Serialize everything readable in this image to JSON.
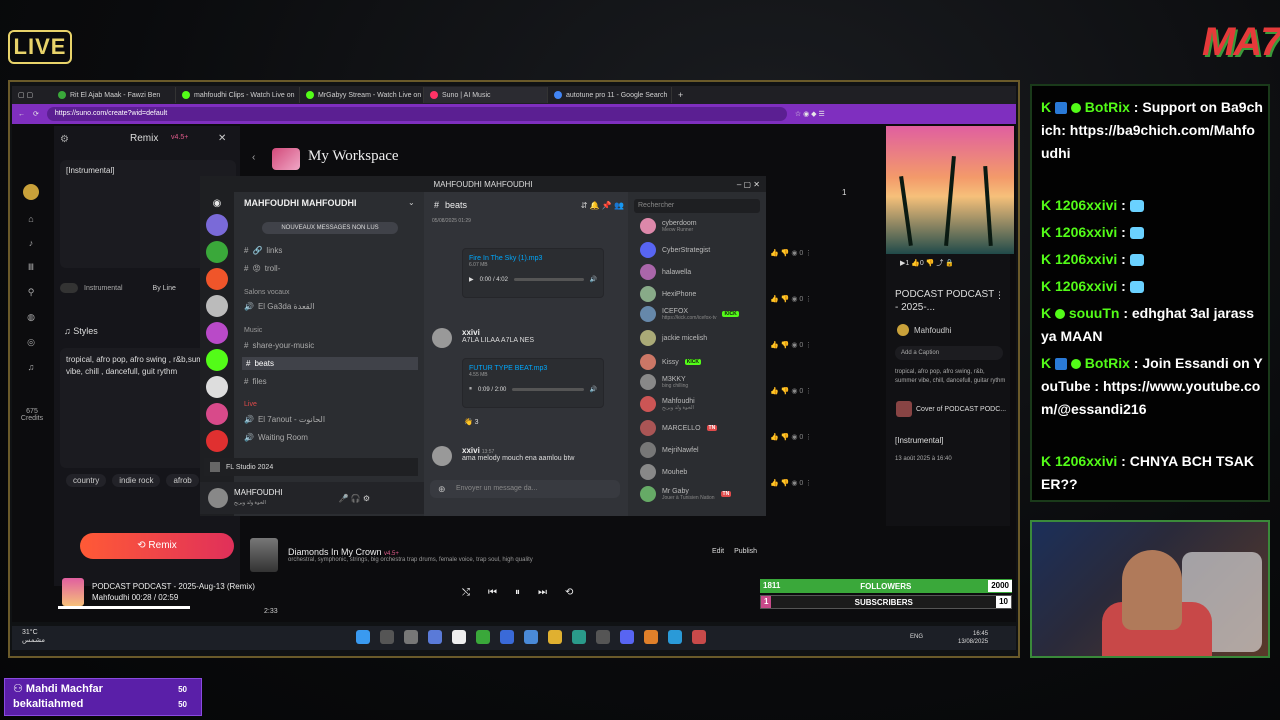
{
  "overlay": {
    "live_label": "LIVE",
    "logo": "MA7",
    "followers": {
      "current": "1811",
      "label": "FOLLOWERS",
      "goal": "2000",
      "fraction": 0.905
    },
    "subscribers": {
      "current": "1",
      "label": "SUBSCRIBERS",
      "goal": "10",
      "fraction": 0.1
    },
    "sub_popup": [
      {
        "name": "Mahdi Machfar",
        "count": "50"
      },
      {
        "name": "bekaltiahmed",
        "count": "50"
      }
    ]
  },
  "browser": {
    "tabs": [
      {
        "label": "Rit El Ajab Maak - Fawzi Ben",
        "color": "#3aa83a"
      },
      {
        "label": "mahfoudhi Clips - Watch Live on",
        "color": "#53fc18"
      },
      {
        "label": "MrGabyy Stream - Watch Live on",
        "color": "#53fc18"
      },
      {
        "label": "Suno | AI Music",
        "color": "#f36"
      },
      {
        "label": "autotune pro 11 - Google Search",
        "color": "#4285f4"
      }
    ],
    "url": "https://suno.com/create?wid=default"
  },
  "suno": {
    "remix_title": "Remix",
    "version": "v4.5+",
    "lyrics": "[Instrumental]",
    "instrumental_label": "Instrumental",
    "by_line_label": "By Line",
    "styles_title": "Styles",
    "styles_text": "tropical, afro pop, afro swing , r&b,summer vibe, chill , dancefull, guit rythm",
    "chips": [
      "country",
      "indie rock",
      "afrob"
    ],
    "credits_value": "675",
    "credits_label": "Credits",
    "remix_button": "Remix",
    "workspace_title": "My Workspace",
    "page_number": "1",
    "right_card": {
      "title": "PODCAST PODCAST - 2025-...",
      "author": "Mahfoudhi",
      "caption_placeholder": "Add a Caption",
      "tags": "tropical, afro pop, afro swing, r&b, summer vibe, chill, dancefull, guitar rythm",
      "cover_of": "Cover of PODCAST PODC...",
      "lyrics": "[Instrumental]",
      "date": "13 août 2025 à 16:40"
    },
    "bottom_song": {
      "title": "Diamonds In My Crown",
      "badge": "v4.5+",
      "desc": "orchestral, symphonic, strings, big orchestra trap drums, female voice, trap soul, high quality",
      "duration": "2:33",
      "edit": "Edit",
      "publish": "Publish"
    },
    "player": {
      "title": "PODCAST PODCAST - 2025-Aug-13 (Remix)",
      "author": "Mahfoudhi",
      "time": "00:28 / 02:59",
      "progress_fraction": 0.16
    }
  },
  "discord": {
    "window_title": "MAHFOUDHI MAHFOUDHI",
    "server_name": "MAHFOUDHI MAHFOUDHI",
    "unread_banner": "NOUVEAUX MESSAGES NON LUS",
    "channels": [
      {
        "label": "links",
        "prefix": "🔗"
      },
      {
        "label": "troll-",
        "prefix": "😡"
      }
    ],
    "voice_category": "Salons vocaux",
    "voice_channels": [
      "El Ga3da القعدة"
    ],
    "music_category": "Music",
    "music_channels": [
      "share-your-music",
      "beats",
      "files"
    ],
    "live_category": "Live",
    "live_channels": [
      "El 7anout - الحانوت",
      "Waiting Room"
    ],
    "fl_studio": "FL Studio 2024",
    "user_name": "MAHFOUDHI",
    "user_status": "الخوة ولد ويربح",
    "active_channel": "beats",
    "search_placeholder": "Rechercher",
    "msg_date": "05/08/2025 01:29",
    "attach1": {
      "name": "Fire In The Sky (1).mp3",
      "size": "6.07 MB",
      "time": "0:00 / 4:02"
    },
    "msg2_author": "xxivi",
    "msg2_text": "A7LA LILAA A7LA NES",
    "attach2": {
      "name": "FUTUR TYPE BEAT.mp3",
      "size": "4.55 MB",
      "time": "0:09 / 2:00"
    },
    "reaction_count": "3",
    "msg3_author": "xxivi",
    "msg3_time": "13:57",
    "msg3_text": "ama melody mouch ena aamlou btw",
    "input_placeholder": "Envoyer un message da...",
    "members": [
      {
        "name": "cyberdoom",
        "sub": "Meow Runner",
        "color": "#d8a"
      },
      {
        "name": "CyberStrategist",
        "sub": "",
        "color": "#5865f2"
      },
      {
        "name": "halawella",
        "sub": "",
        "color": "#a6a"
      },
      {
        "name": "HexiPhone",
        "sub": "",
        "color": "#8a8"
      },
      {
        "name": "ICEFOX",
        "sub": "https://kick.com/icefox-tv",
        "color": "#68a",
        "kick": true
      },
      {
        "name": "jackie micelish",
        "sub": "",
        "color": "#aa7"
      },
      {
        "name": "Kissy",
        "sub": "",
        "color": "#c76",
        "kick": true
      },
      {
        "name": "M3KKY",
        "sub": "bing chilling",
        "color": "#888"
      },
      {
        "name": "Mahfoudhi",
        "sub": "الخوة ولد ويربح",
        "color": "#c55"
      },
      {
        "name": "MARCELLO",
        "sub": "",
        "color": "#a55",
        "badge": "TN"
      },
      {
        "name": "MejriNawfel",
        "sub": "",
        "color": "#777"
      },
      {
        "name": "Mouheb",
        "sub": "",
        "color": "#888"
      },
      {
        "name": "Mr Gaby",
        "sub": "Jouer à Tunisien Nation",
        "color": "#6a6",
        "badge": "TN"
      }
    ]
  },
  "taskbar": {
    "weather_temp": "31°C",
    "weather_desc": "مشمس",
    "lang": "ENG",
    "time": "16:45",
    "date": "13/08/2025"
  },
  "chat": [
    {
      "user": "BotRix",
      "bot": true,
      "text": "Support on Ba9chich: https://ba9chich.com/Mahfoudhi"
    },
    {
      "user": "1206xxivi",
      "bot": false,
      "text": ""
    },
    {
      "user": "1206xxivi",
      "bot": false,
      "text": ""
    },
    {
      "user": "1206xxivi",
      "bot": false,
      "text": ""
    },
    {
      "user": "1206xxivi",
      "bot": false,
      "text": ""
    },
    {
      "user": "souuTn",
      "bot": false,
      "text": "edhghat 3al jarass ya MAAN"
    },
    {
      "user": "BotRix",
      "bot": true,
      "text": "Join Essandi on YouTube : https://www.youtube.com/@essandi216"
    },
    {
      "user": "1206xxivi",
      "bot": false,
      "text": "CHNYA BCH TSAKER??"
    }
  ]
}
